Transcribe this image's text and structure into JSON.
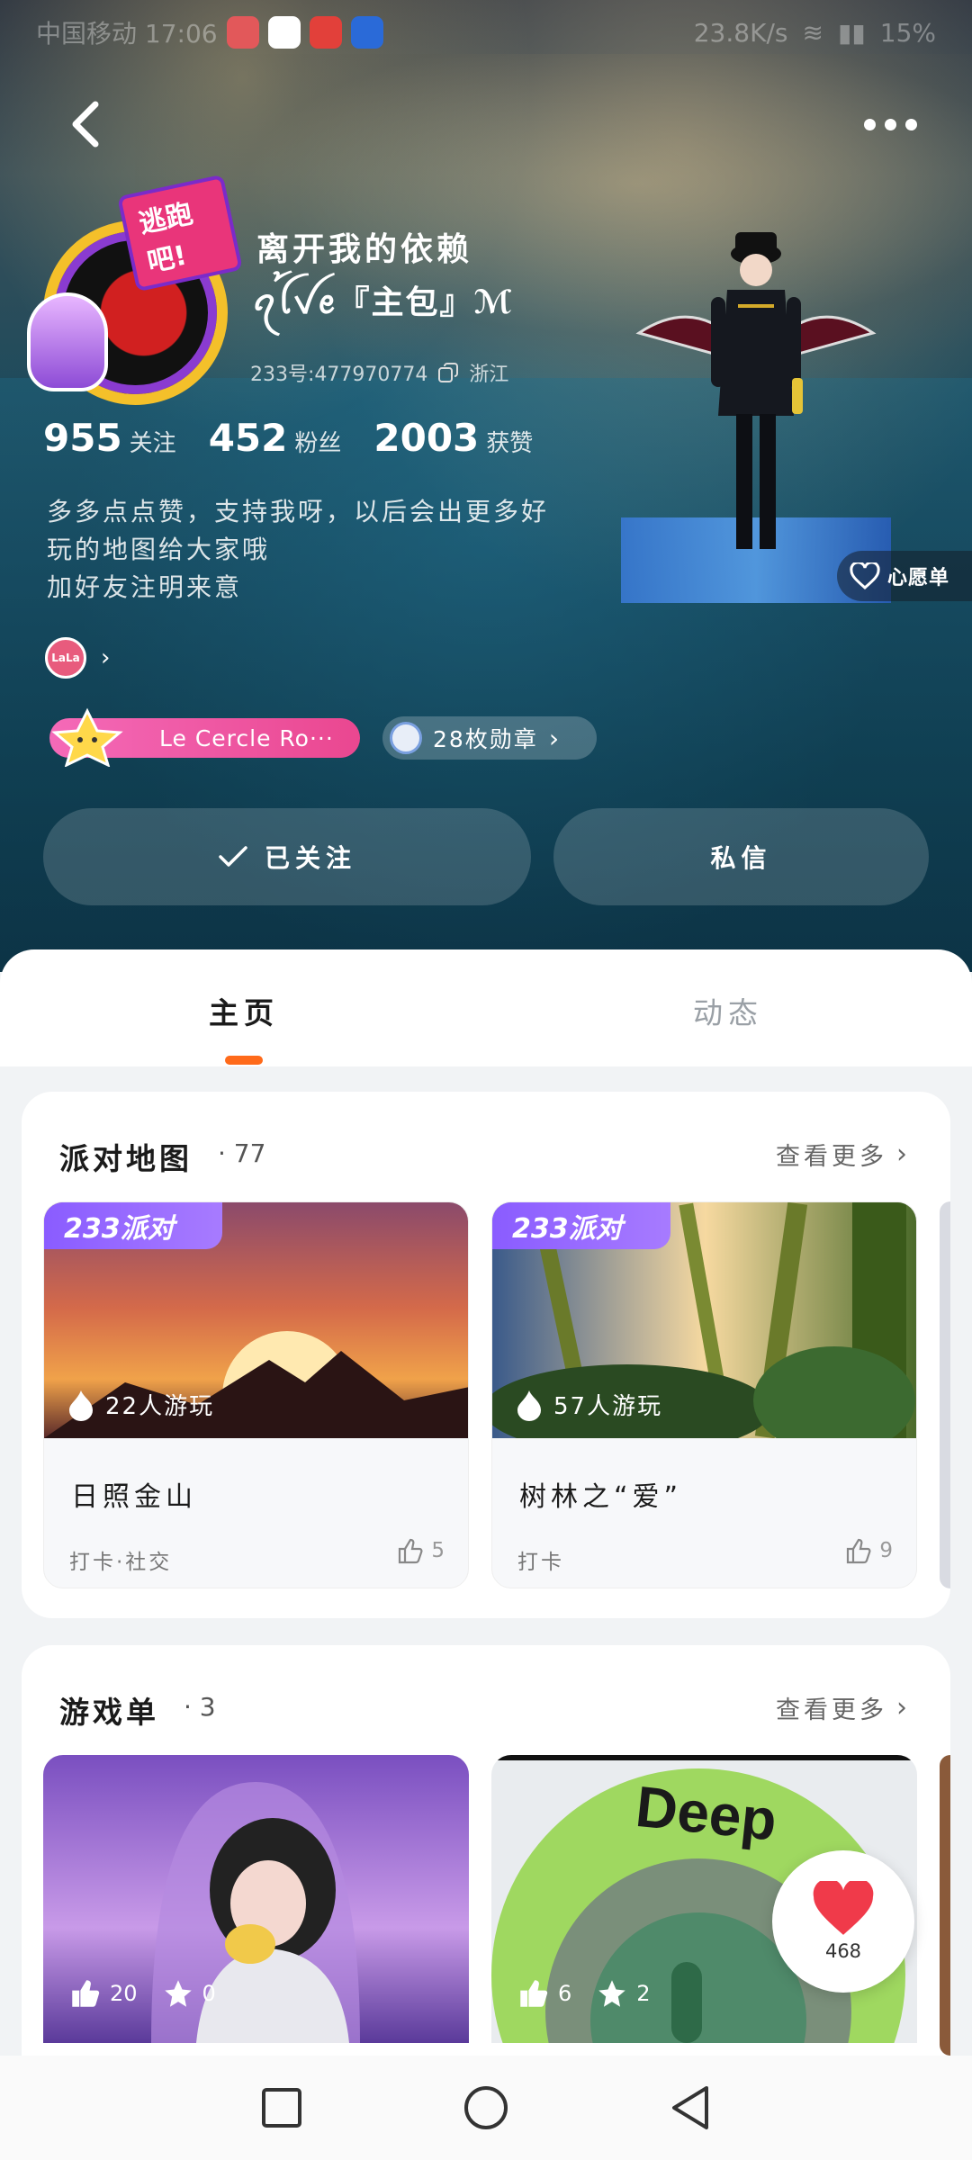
{
  "status_bar": {
    "carrier_time": "中国移动 17:06",
    "net_speed": "23.8K/s",
    "battery": "15%"
  },
  "profile": {
    "nickname_line1": "离开我的依赖",
    "nickname_line2": "ꪖꪶ꫁ꪜꫀ『主包』ℳ",
    "uid_label": "233号:477970774",
    "location": "浙江",
    "stats": [
      {
        "value": "955",
        "label": "关注"
      },
      {
        "value": "452",
        "label": "粉丝"
      },
      {
        "value": "2003",
        "label": "获赞"
      }
    ],
    "bio_lines": [
      "多多点点赞，支持我呀，以后会出更多好",
      "玩的地图给大家哦",
      "加好友注明来意"
    ],
    "mini_avatar_text": "LaLa",
    "avatar_sticker": "逃跑吧!",
    "club_name": "Le Cercle Ro···",
    "badges_label": "28枚勋章",
    "wishlist_label": "心愿单",
    "follow_label": "已关注",
    "message_label": "私信"
  },
  "tabs": [
    {
      "label": "主页",
      "active": true
    },
    {
      "label": "动态",
      "active": false
    }
  ],
  "party_maps": {
    "title": "派对地图",
    "count": "· 77",
    "more_label": "查看更多",
    "items": [
      {
        "tag": "233派对",
        "players": "22人游玩",
        "name": "日照金山",
        "tags": "打卡·社交",
        "likes": "5"
      },
      {
        "tag": "233派对",
        "players": "57人游玩",
        "name": "树林之“爱”",
        "tags": "打卡",
        "likes": "9"
      }
    ]
  },
  "game_lists": {
    "title": "游戏单",
    "count": "· 3",
    "more_label": "查看更多",
    "items": [
      {
        "likes": "20",
        "stars": "0"
      },
      {
        "likes": "6",
        "stars": "2",
        "logo_text": "Deep"
      }
    ]
  },
  "floating_like": {
    "count": "468"
  },
  "colors": {
    "accent_orange": "#ff6a1a",
    "party_tag_purple": "#8a5cff",
    "club_pink": "#ea4790",
    "heart_red": "#f03a4a"
  }
}
